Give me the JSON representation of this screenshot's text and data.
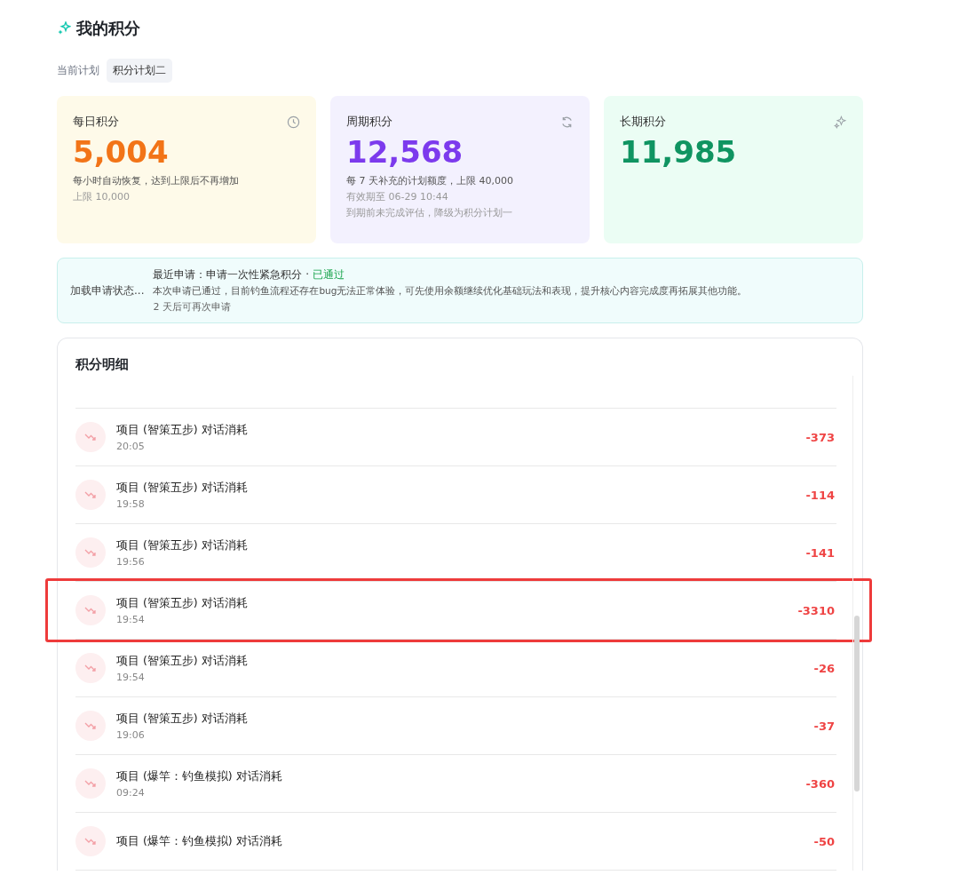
{
  "title": "我的积分",
  "plan": {
    "label": "当前计划",
    "value": "积分计划二"
  },
  "cards": [
    {
      "kind": "daily",
      "label": "每日积分",
      "value": "5,004",
      "notes": [
        "每小时自动恢复，达到上限后不再增加"
      ],
      "subnotes": [
        "上限 10,000"
      ]
    },
    {
      "kind": "cycle",
      "label": "周期积分",
      "value": "12,568",
      "notes": [
        "每 7 天补充的计划额度，上限 40,000"
      ],
      "subnotes": [
        "有效期至 06-29 10:44",
        "到期前未完成评估，降级为积分计划一"
      ]
    },
    {
      "kind": "long",
      "label": "长期积分",
      "value": "11,985"
    }
  ],
  "request": {
    "label": "加载申请状态...",
    "latest": "最近申请：申请一次性紧急积分 · ",
    "status": "已通过",
    "message": "本次申请已通过，目前钓鱼流程还存在bug无法正常体验，可先使用余额继续优化基础玩法和表现，提升核心内容完成度再拓展其他功能。",
    "retry": "2 天后可再次申请"
  },
  "details": {
    "title": "积分明细",
    "rows": [
      {
        "title": "项目 (智策五步) 对话消耗",
        "time": "20:05",
        "amount": "-373",
        "highlighted": false
      },
      {
        "title": "项目 (智策五步) 对话消耗",
        "time": "19:58",
        "amount": "-114",
        "highlighted": false
      },
      {
        "title": "项目 (智策五步) 对话消耗",
        "time": "19:56",
        "amount": "-141",
        "highlighted": false
      },
      {
        "title": "项目 (智策五步) 对话消耗",
        "time": "19:54",
        "amount": "-3310",
        "highlighted": true
      },
      {
        "title": "项目 (智策五步) 对话消耗",
        "time": "19:54",
        "amount": "-26",
        "highlighted": false
      },
      {
        "title": "项目 (智策五步) 对话消耗",
        "time": "19:06",
        "amount": "-37",
        "highlighted": false
      },
      {
        "title": "项目 (爆竿：钓鱼模拟) 对话消耗",
        "time": "09:24",
        "amount": "-360",
        "highlighted": false
      },
      {
        "title": "项目 (爆竿：钓鱼模拟) 对话消耗",
        "amount": "-50",
        "highlighted": false
      }
    ]
  }
}
